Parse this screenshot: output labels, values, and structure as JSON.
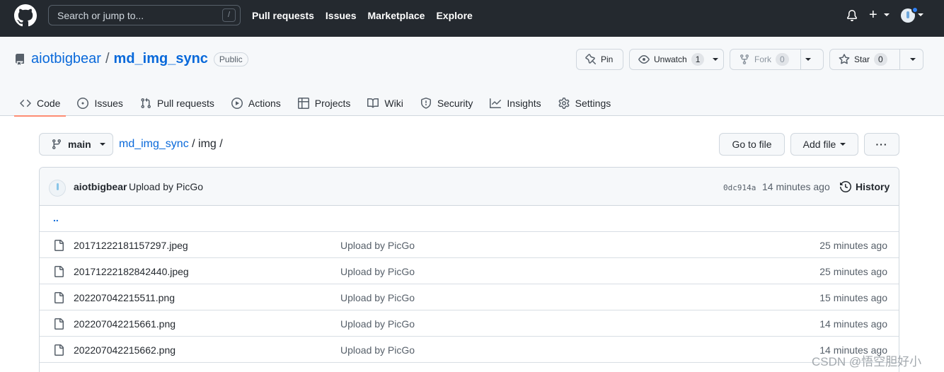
{
  "header": {
    "search_placeholder": "Search or jump to...",
    "search_shortcut": "/",
    "nav": [
      "Pull requests",
      "Issues",
      "Marketplace",
      "Explore"
    ],
    "plus": "+"
  },
  "repo": {
    "owner": "aiotbigbear",
    "separator": "/",
    "name": "md_img_sync",
    "visibility": "Public",
    "pin_label": "Pin",
    "watch_label": "Unwatch",
    "watch_count": "1",
    "fork_label": "Fork",
    "fork_count": "0",
    "star_label": "Star",
    "star_count": "0"
  },
  "tabs": [
    "Code",
    "Issues",
    "Pull requests",
    "Actions",
    "Projects",
    "Wiki",
    "Security",
    "Insights",
    "Settings"
  ],
  "file_nav": {
    "branch": "main",
    "breadcrumb_repo": "md_img_sync",
    "breadcrumb_rest": " / img /",
    "go_to_file": "Go to file",
    "add_file": "Add file",
    "more": "···"
  },
  "commit": {
    "author": "aiotbigbear",
    "message": "Upload by PicGo",
    "sha": "0dc914a",
    "time": "14 minutes ago",
    "history": "History"
  },
  "parent_dir": "..",
  "files": [
    {
      "name": "20171222181157297.jpeg",
      "message": "Upload by PicGo",
      "time": "25 minutes ago"
    },
    {
      "name": "20171222182842440.jpeg",
      "message": "Upload by PicGo",
      "time": "25 minutes ago"
    },
    {
      "name": "202207042215511.png",
      "message": "Upload by PicGo",
      "time": "15 minutes ago"
    },
    {
      "name": "202207042215661.png",
      "message": "Upload by PicGo",
      "time": "14 minutes ago"
    },
    {
      "name": "202207042215662.png",
      "message": "Upload by PicGo",
      "time": "14 minutes ago"
    }
  ],
  "watermark": "CSDN @悟空胆好小",
  "colors": {
    "header_bg": "#24292f",
    "link": "#0969da",
    "active_tab": "#fd8c73"
  }
}
